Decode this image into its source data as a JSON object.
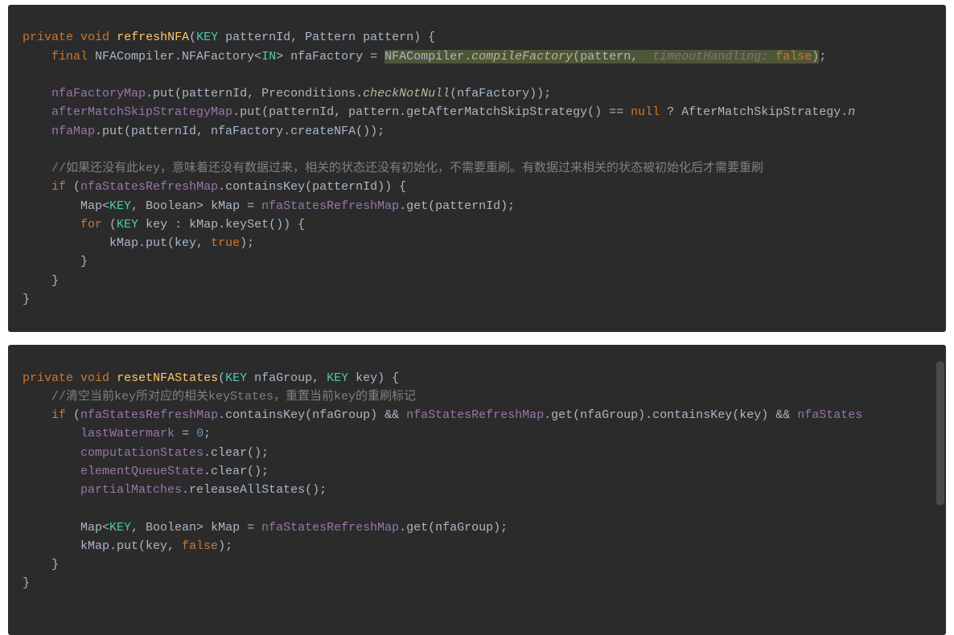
{
  "block1": {
    "l1": {
      "private": "private",
      "void": "void",
      "name": "refreshNFA",
      "t_key": "KEY",
      "p1": " patternId, Pattern pattern) {"
    },
    "l2": {
      "final": "final",
      "pre": " NFACompiler.NFAFactory<",
      "t_in": "IN",
      "mid": "> nfaFactory = ",
      "hl_a": "NFACompiler.",
      "hl_call": "compileFactory",
      "hl_b": "(pattern, ",
      "hint": " timeoutHandling: ",
      "false": "false",
      "hl_c": ")",
      "semi": ";"
    },
    "l4": {
      "field": "nfaFactoryMap",
      "mid": ".put(patternId, Preconditions.",
      "call": "checkNotNull",
      "end": "(nfaFactory));"
    },
    "l5": {
      "field": "afterMatchSkipStrategyMap",
      "mid": ".put(patternId, pattern.getAfterMatchSkipStrategy() == ",
      "null": "null",
      "q": " ? AfterMatchSkipStrategy.",
      "tail": "n"
    },
    "l6": {
      "field": "nfaMap",
      "rest": ".put(patternId, nfaFactory.createNFA());"
    },
    "comment": "//如果还没有此key，意味着还没有数据过来，相关的状态还没有初始化，不需要重刷。有数据过来相关的状态被初始化后才需要重刷",
    "l9": {
      "if": "if",
      "open": " (",
      "field": "nfaStatesRefreshMap",
      "rest": ".containsKey(patternId)) {"
    },
    "l10": {
      "pre": "Map<",
      "t_key": "KEY",
      "mid": ", Boolean> kMap = ",
      "field": "nfaStatesRefreshMap",
      "end": ".get(patternId);"
    },
    "l11": {
      "for": "for",
      "open": " (",
      "t_key": "KEY",
      "rest": " key : kMap.keySet()) {"
    },
    "l12": {
      "pre": "kMap.put(key, ",
      "true": "true",
      "end": ");"
    },
    "l13": "}",
    "l14": "}",
    "l15": "}"
  },
  "block2": {
    "l1": {
      "private": "private",
      "void": "void",
      "name": "resetNFAStates",
      "t_key1": "KEY",
      "mid": " nfaGroup, ",
      "t_key2": "KEY",
      "end": " key) {"
    },
    "comment": "//清空当前key所对应的相关keyStates，重置当前key的重刷标记",
    "l3": {
      "if": "if",
      "open": " (",
      "f1": "nfaStatesRefreshMap",
      "a": ".containsKey(nfaGroup) && ",
      "f2": "nfaStatesRefreshMap",
      "b": ".get(nfaGroup).containsKey(key) && ",
      "f3": "nfaStates"
    },
    "l4": {
      "field": "lastWatermark",
      "eq": " = ",
      "num": "0",
      "semi": ";"
    },
    "l5": {
      "field": "computationStates",
      "rest": ".clear();"
    },
    "l6": {
      "field": "elementQueueState",
      "rest": ".clear();"
    },
    "l7": {
      "field": "partialMatches",
      "rest": ".releaseAllStates();"
    },
    "l9": {
      "pre": "Map<",
      "t_key": "KEY",
      "mid": ", Boolean> kMap = ",
      "field": "nfaStatesRefreshMap",
      "end": ".get(nfaGroup);"
    },
    "l10": {
      "pre": "kMap.put(key, ",
      "false": "false",
      "end": ");"
    },
    "l11": "}",
    "l12": "}"
  }
}
